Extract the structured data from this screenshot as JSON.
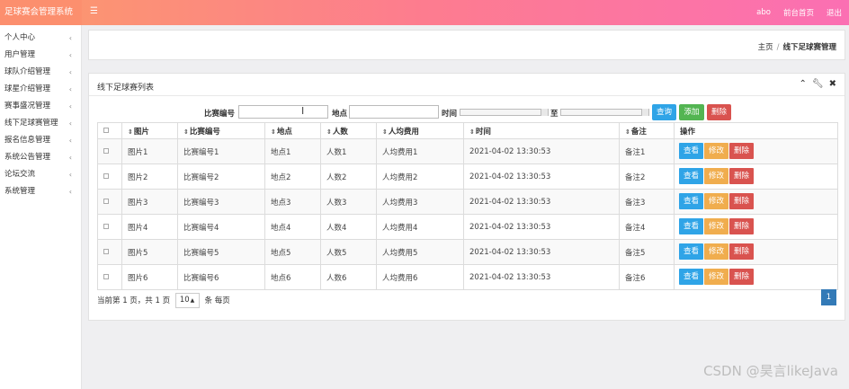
{
  "app": {
    "title": "足球赛会管理系统"
  },
  "header": {
    "menu_icon": "hamburger-icon",
    "user": "abo",
    "links": [
      "前台首页",
      "退出"
    ]
  },
  "sidebar": {
    "items": [
      {
        "label": "个人中心"
      },
      {
        "label": "用户管理"
      },
      {
        "label": "球队介绍管理"
      },
      {
        "label": "球星介绍管理"
      },
      {
        "label": "赛事盛况管理"
      },
      {
        "label": "线下足球赛管理"
      },
      {
        "label": "报名信息管理"
      },
      {
        "label": "系统公告管理"
      },
      {
        "label": "论坛交流"
      },
      {
        "label": "系统管理"
      }
    ],
    "chevron": "‹"
  },
  "breadcrumb": {
    "home": "主页",
    "separator": "/",
    "current": "线下足球赛管理"
  },
  "panel": {
    "title": "线下足球赛列表",
    "tools": [
      "chevron-up-icon",
      "wrench-icon",
      "close-icon"
    ]
  },
  "search": {
    "code_label": "比赛编号",
    "code_value": "",
    "place_label": "地点",
    "place_value": "",
    "time_label": "时间",
    "to_label": "至",
    "query_button": "查询",
    "add_button": "添加",
    "delete_button": "删除"
  },
  "table": {
    "headers": [
      "图片",
      "比赛编号",
      "地点",
      "人数",
      "人均费用",
      "时间",
      "备注",
      "操作"
    ],
    "rows": [
      {
        "image": "图片1",
        "code": "比赛编号1",
        "place": "地点1",
        "count": "人数1",
        "fee": "人均费用1",
        "time": "2021-04-02 13:30:53",
        "note": "备注1"
      },
      {
        "image": "图片2",
        "code": "比赛编号2",
        "place": "地点2",
        "count": "人数2",
        "fee": "人均费用2",
        "time": "2021-04-02 13:30:53",
        "note": "备注2"
      },
      {
        "image": "图片3",
        "code": "比赛编号3",
        "place": "地点3",
        "count": "人数3",
        "fee": "人均费用3",
        "time": "2021-04-02 13:30:53",
        "note": "备注3"
      },
      {
        "image": "图片4",
        "code": "比赛编号4",
        "place": "地点4",
        "count": "人数4",
        "fee": "人均费用4",
        "time": "2021-04-02 13:30:53",
        "note": "备注4"
      },
      {
        "image": "图片5",
        "code": "比赛编号5",
        "place": "地点5",
        "count": "人数5",
        "fee": "人均费用5",
        "time": "2021-04-02 13:30:53",
        "note": "备注5"
      },
      {
        "image": "图片6",
        "code": "比赛编号6",
        "place": "地点6",
        "count": "人数6",
        "fee": "人均费用6",
        "time": "2021-04-02 13:30:53",
        "note": "备注6"
      }
    ],
    "row_actions": {
      "view": "查看",
      "edit": "修改",
      "delete": "删除"
    }
  },
  "pager": {
    "summary": "当前第 1 页，共 1 页",
    "page_size": "10",
    "per_page_suffix": "条 每页",
    "current_page": "1"
  },
  "watermark": "CSDN @昊言likeJava",
  "colors": {
    "header_start": "#fb9a6b",
    "header_end": "#fb6fb3",
    "query": "#2fa4e7",
    "add": "#53b552",
    "delete": "#d9534f",
    "edit": "#f0ad4e",
    "page_active": "#337ab7"
  }
}
